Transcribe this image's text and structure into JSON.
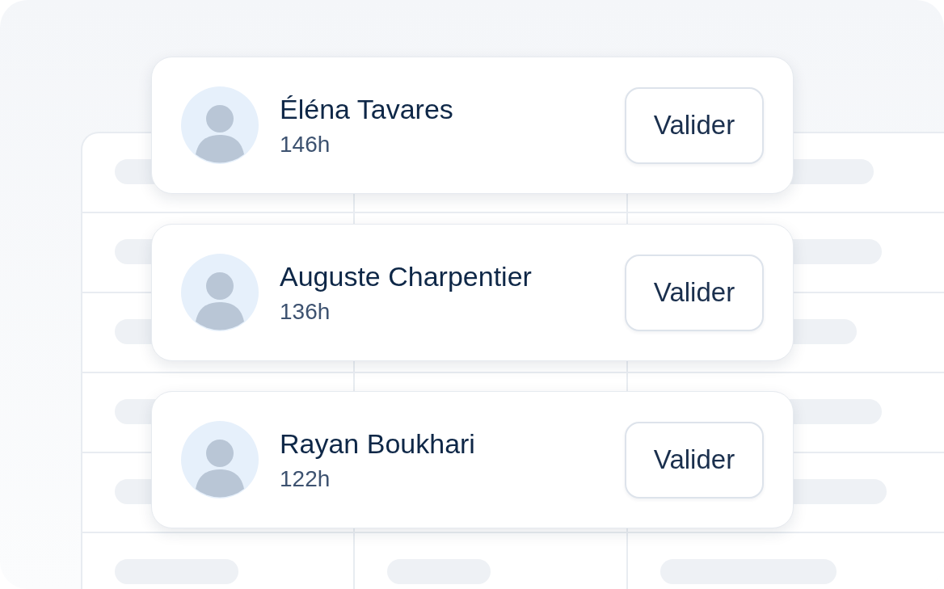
{
  "people": [
    {
      "name": "Éléna Tavares",
      "hours": "146h",
      "action": "Valider"
    },
    {
      "name": "Auguste Charpentier",
      "hours": "136h",
      "action": "Valider"
    },
    {
      "name": "Rayan Boukhari",
      "hours": "122h",
      "action": "Valider"
    }
  ]
}
